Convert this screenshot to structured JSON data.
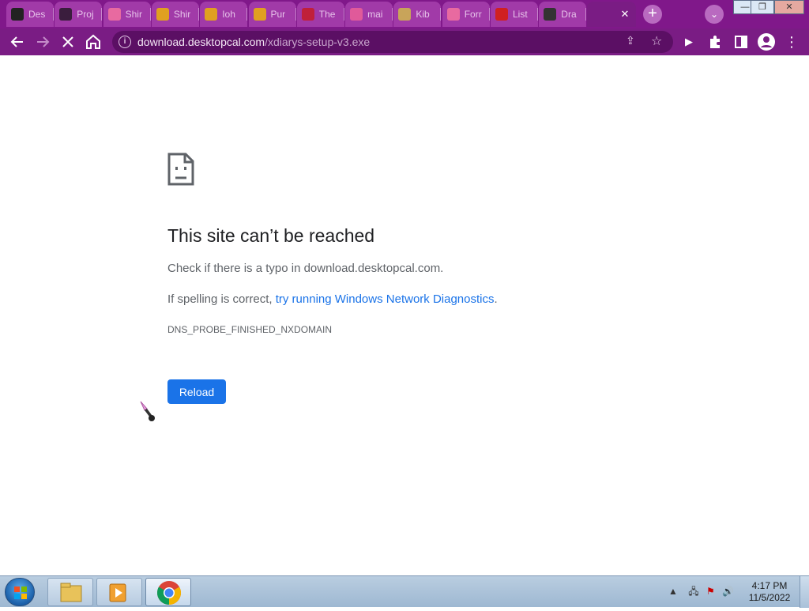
{
  "browser": {
    "tabs": [
      {
        "title": "Des",
        "favicon": "dark-app-icon",
        "color": "#222222"
      },
      {
        "title": "Proj",
        "favicon": "dark-app-icon",
        "color": "#3a1d3d"
      },
      {
        "title": "Shir",
        "favicon": "rainbow-icon",
        "color": "#e86aa0"
      },
      {
        "title": "Shir",
        "favicon": "character-icon",
        "color": "#e0a020"
      },
      {
        "title": "Ioh",
        "favicon": "character-icon",
        "color": "#e0a020"
      },
      {
        "title": "Pur",
        "favicon": "character-icon",
        "color": "#e0a020"
      },
      {
        "title": "The",
        "favicon": "red-logo-icon",
        "color": "#c0203a"
      },
      {
        "title": "mai",
        "favicon": "sp-logo-icon",
        "color": "#e05a9a"
      },
      {
        "title": "Kib",
        "favicon": "gold-icon",
        "color": "#c8a45a"
      },
      {
        "title": "Forr",
        "favicon": "rainbow-icon",
        "color": "#e86aa0"
      },
      {
        "title": "List",
        "favicon": "mario-icon",
        "color": "#d02020"
      },
      {
        "title": "Dra",
        "favicon": "power-icon",
        "color": "#333333"
      }
    ],
    "active_tab_title": "",
    "url_host": "download.desktopcal.com",
    "url_path": "/xdiarys-setup-v3.exe",
    "accent_color": "#7a1c84"
  },
  "error_page": {
    "title": "This site can’t be reached",
    "line1": "Check if there is a typo in download.desktopcal.com.",
    "line2_prefix": "If spelling is correct, ",
    "line2_link": "try running Windows Network Diagnostics",
    "line2_suffix": ".",
    "code": "DNS_PROBE_FINISHED_NXDOMAIN",
    "reload_label": "Reload",
    "button_color": "#1a73e8"
  },
  "taskbar": {
    "apps": [
      "file-explorer-icon",
      "media-player-icon",
      "chrome-icon"
    ],
    "time": "4:17 PM",
    "date": "11/5/2022"
  }
}
